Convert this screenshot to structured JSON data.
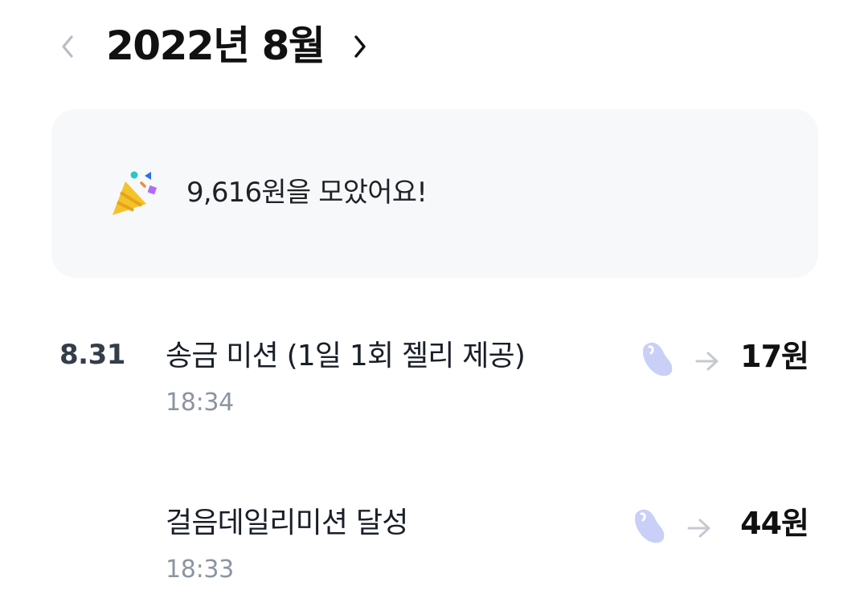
{
  "header": {
    "month_title": "2022년 8월",
    "prev_icon": "chevron-left-icon",
    "next_icon": "chevron-right-icon"
  },
  "summary": {
    "icon": "party-popper-icon",
    "text": "9,616원을 모았어요!"
  },
  "transactions": [
    {
      "date": "8.31",
      "title": "송금 미션 (1일 1회 젤리 제공)",
      "time": "18:34",
      "amount": "17원",
      "icon": "jelly-icon"
    },
    {
      "date": "",
      "title": "걸음데일리미션 달성",
      "time": "18:33",
      "amount": "44원",
      "icon": "jelly-icon"
    }
  ],
  "colors": {
    "card_background": "#f7f8fa",
    "muted_text": "#8b95a1",
    "primary_text": "#191f28",
    "jelly": "#c9cff7"
  }
}
